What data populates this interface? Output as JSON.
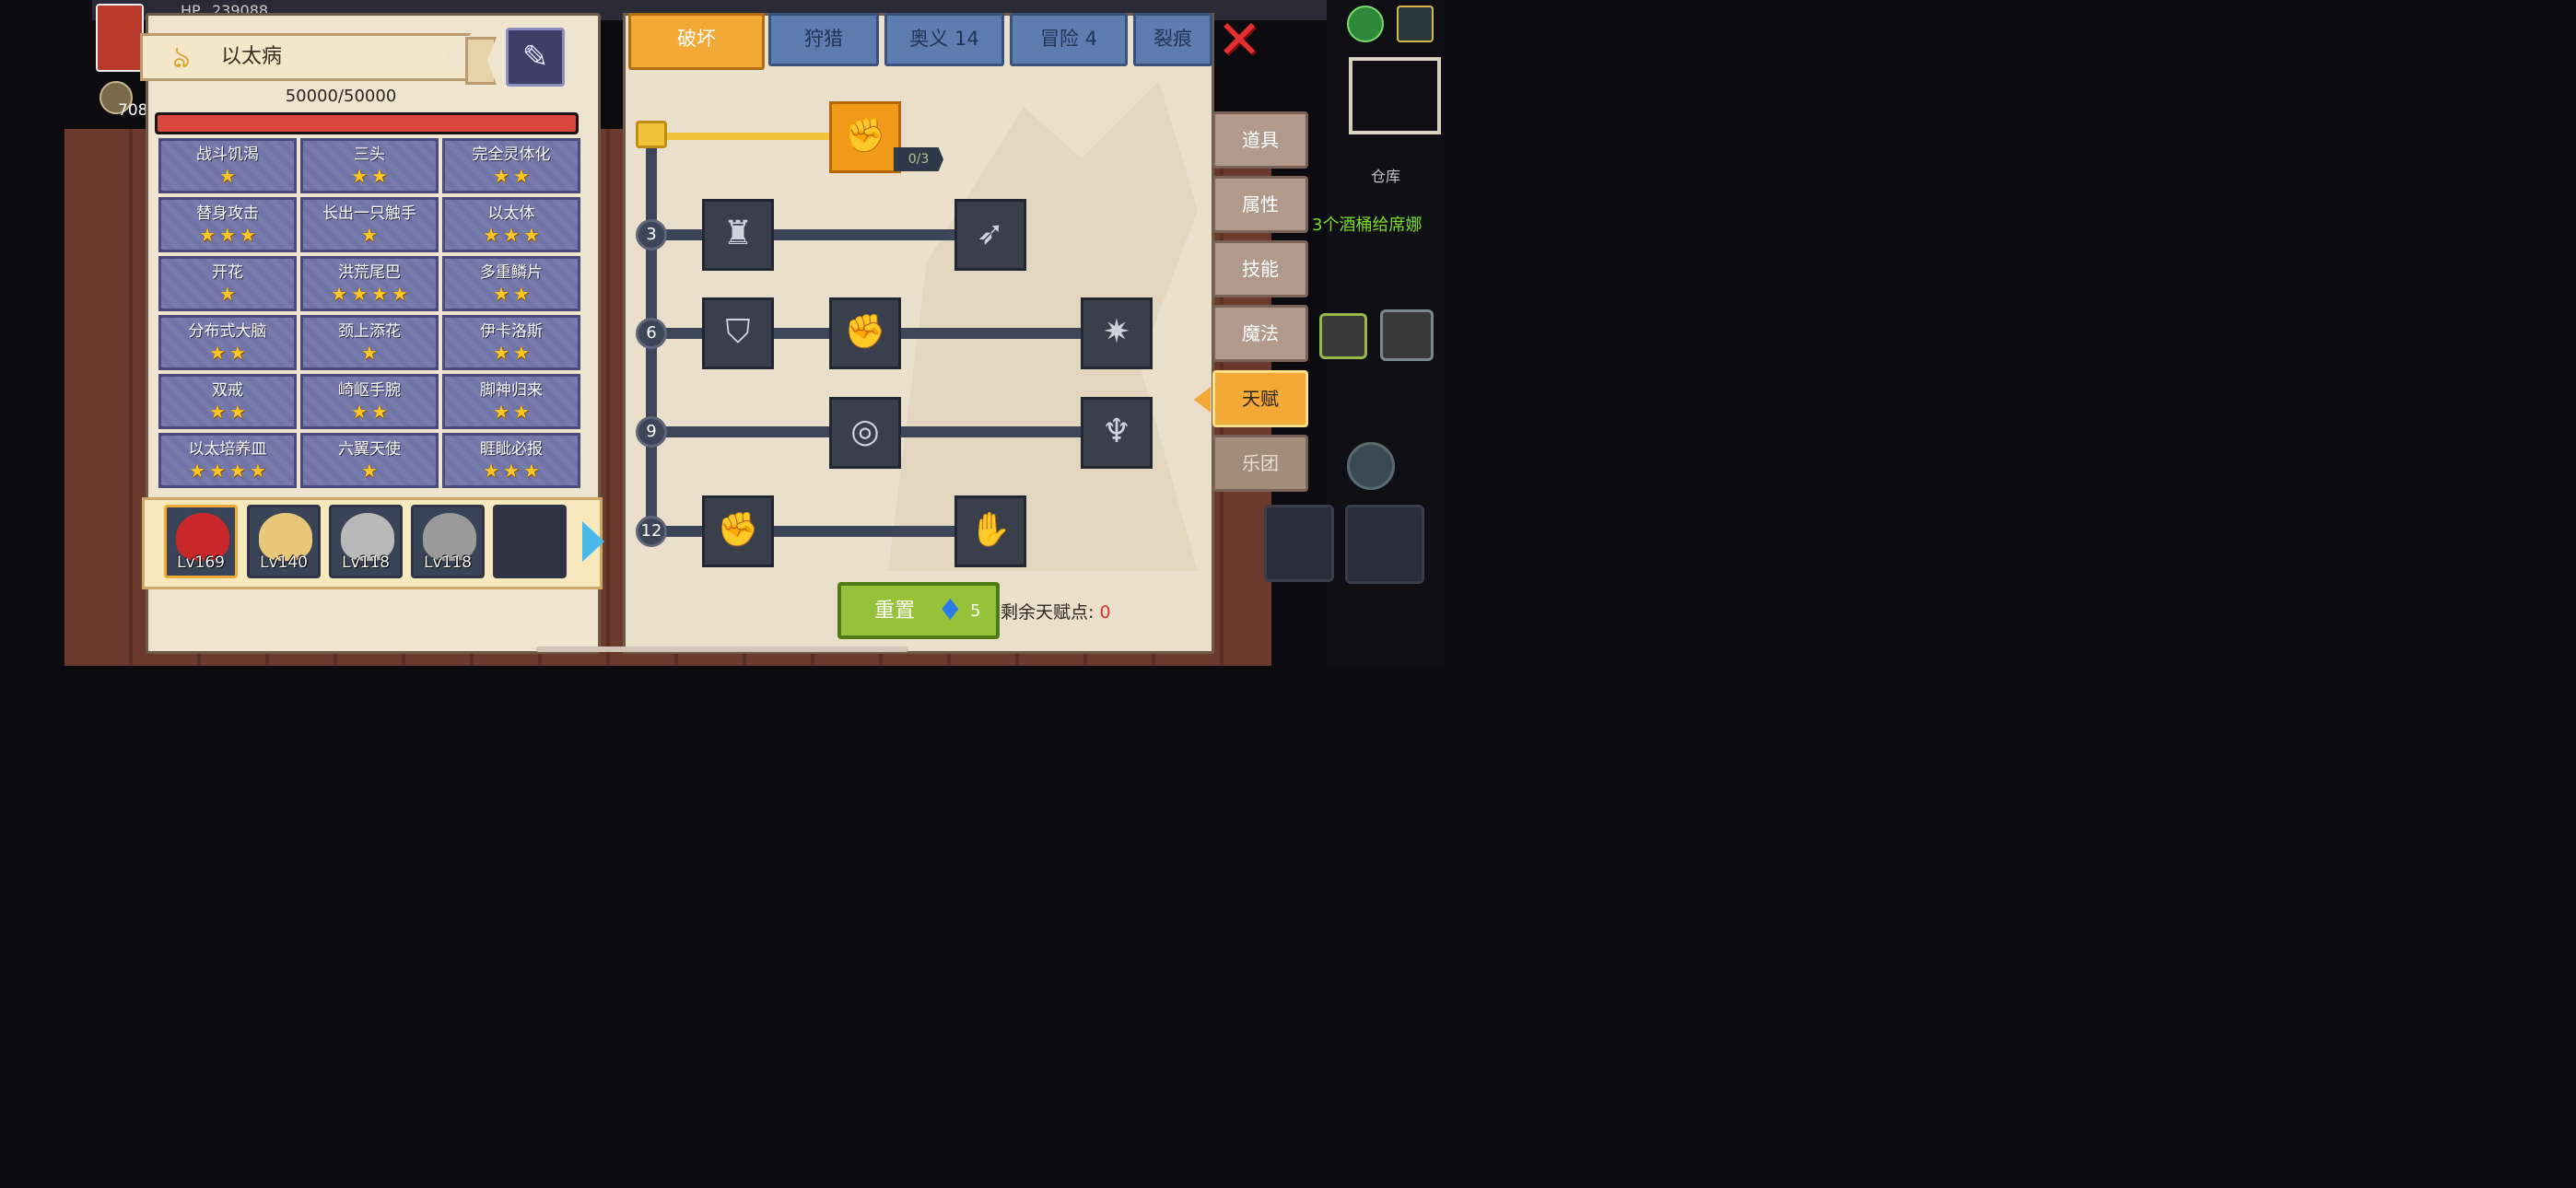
{
  "boss": {
    "name": "以太病",
    "hp_text": "50000/50000",
    "hp_fraction": 1.0
  },
  "traits": [
    {
      "name": "战斗饥渴",
      "stars": 1
    },
    {
      "name": "三头",
      "stars": 2
    },
    {
      "name": "完全灵体化",
      "stars": 2
    },
    {
      "name": "替身攻击",
      "stars": 3
    },
    {
      "name": "长出一只触手",
      "stars": 1
    },
    {
      "name": "以太体",
      "stars": 3
    },
    {
      "name": "开花",
      "stars": 1
    },
    {
      "name": "洪荒尾巴",
      "stars": 4
    },
    {
      "name": "多重鳞片",
      "stars": 2
    },
    {
      "name": "分布式大脑",
      "stars": 2
    },
    {
      "name": "颈上添花",
      "stars": 1
    },
    {
      "name": "伊卡洛斯",
      "stars": 2
    },
    {
      "name": "双戒",
      "stars": 2
    },
    {
      "name": "崎岖手腕",
      "stars": 2
    },
    {
      "name": "脚神归来",
      "stars": 2
    },
    {
      "name": "以太培养皿",
      "stars": 4
    },
    {
      "name": "六翼天使",
      "stars": 1
    },
    {
      "name": "睚眦必报",
      "stars": 3
    }
  ],
  "team": [
    {
      "level": "Lv169"
    },
    {
      "level": "Lv140"
    },
    {
      "level": "Lv118"
    },
    {
      "level": "Lv118"
    }
  ],
  "tabs": {
    "destroy": "破坏",
    "hunt": "狩猎",
    "mystery": "奥义 14",
    "adventure": "冒险 4",
    "rift": "裂痕"
  },
  "talent_tree": {
    "top_node_count": "0/3",
    "tiers": [
      "3",
      "6",
      "9",
      "12"
    ]
  },
  "reset": {
    "label": "重置",
    "gem_count": "5"
  },
  "remaining_points": {
    "label": "剩余天赋点:",
    "value": "0"
  },
  "side_tabs": {
    "items": "道具",
    "attributes": "属性",
    "skills": "技能",
    "magic": "魔法",
    "talent": "天赋",
    "band": "乐团"
  },
  "hud": {
    "warehouse": "仓库",
    "quest": "3个酒桶给席娜",
    "gold_count": "708",
    "hp_label": "HP",
    "hp_value": "239088"
  },
  "colors": {
    "accent": "#f2a936",
    "hp": "#d8463c",
    "star": "#ffc826",
    "tab_blue": "#5d7cb0",
    "cell_purple": "#7074a6"
  }
}
